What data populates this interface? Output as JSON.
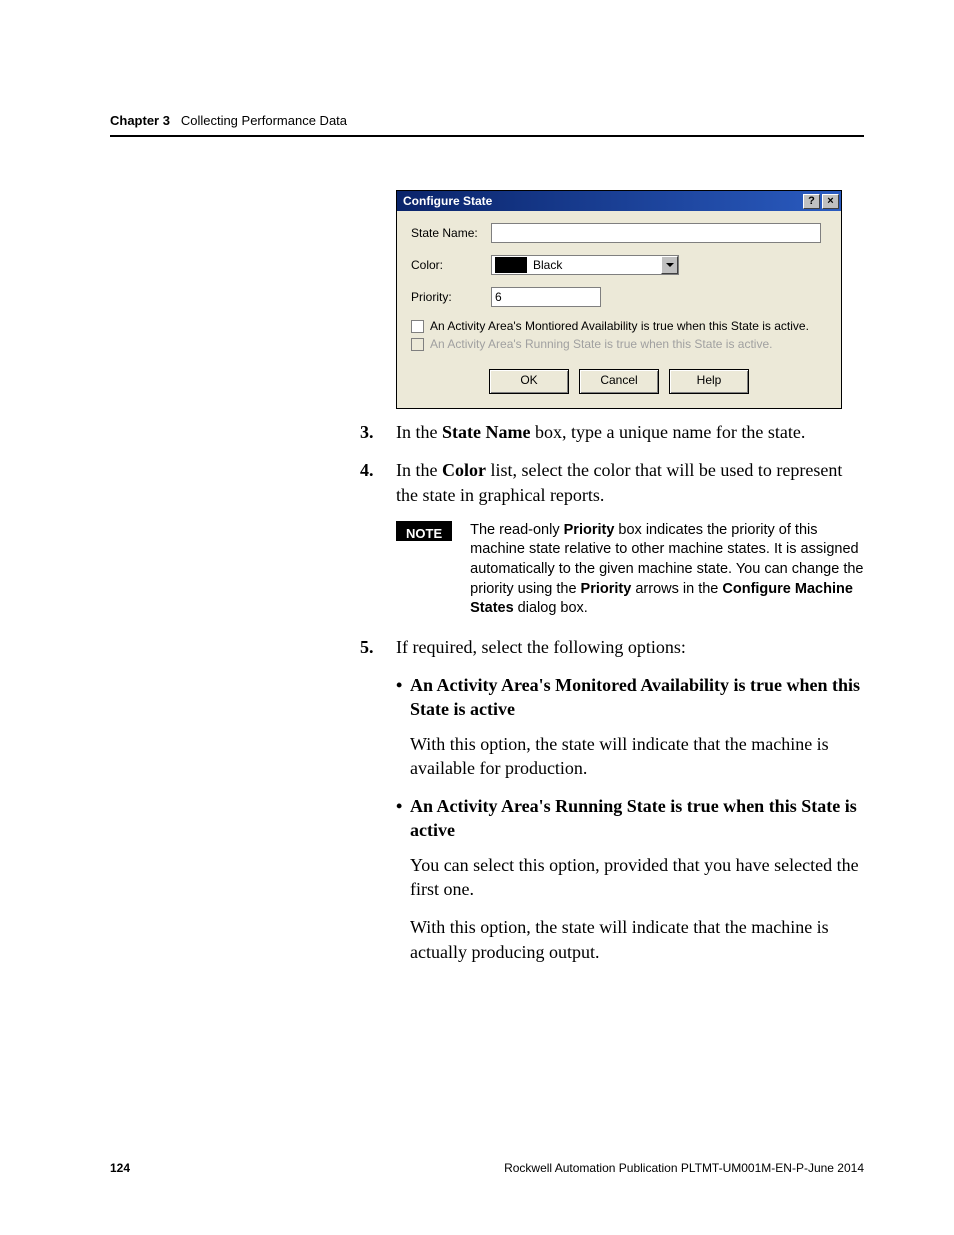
{
  "header": {
    "chapter": "Chapter 3",
    "title": "Collecting Performance Data"
  },
  "dialog": {
    "title": "Configure State",
    "help_btn": "?",
    "close_btn": "×",
    "labels": {
      "state_name": "State Name:",
      "color": "Color:",
      "priority": "Priority:"
    },
    "fields": {
      "state_name_value": "",
      "color_value": "Black",
      "priority_value": "6"
    },
    "checkboxes": {
      "avail": "An Activity Area's Montiored Availability is true when this State is active.",
      "running": "An Activity Area's Running State is true when this State is active."
    },
    "buttons": {
      "ok": "OK",
      "cancel": "Cancel",
      "help": "Help"
    }
  },
  "steps": {
    "s3_num": "3.",
    "s3_a": "In the ",
    "s3_b": "State Name",
    "s3_c": " box, type a unique name for the state.",
    "s4_num": "4.",
    "s4_a": "In the ",
    "s4_b": "Color",
    "s4_c": " list, select the color that will be used to represent the state in graphical reports.",
    "s5_num": "5.",
    "s5": "If required, select the following options:"
  },
  "note": {
    "badge": "NOTE",
    "t1": "The read-only ",
    "t2": "Priority",
    "t3": " box indicates the priority of this machine state relative to other machine states. It is assigned automatically to the given machine state. You can change the priority using the ",
    "t4": "Priority",
    "t5": " arrows in the ",
    "t6": "Configure Machine States",
    "t7": " dialog box."
  },
  "bullets": {
    "b1": "An Activity Area's Monitored Availability is true when this State is active",
    "b1_p": "With this option, the state will indicate that the machine is available for production.",
    "b2": "An Activity Area's Running State is true when this State is active",
    "b2_p1": "You can select this option, provided that you have selected the first one.",
    "b2_p2": "With this option, the state will indicate that the machine is actually producing output."
  },
  "footer": {
    "page": "124",
    "pub": "Rockwell Automation Publication PLTMT-UM001M-EN-P-June 2014"
  }
}
